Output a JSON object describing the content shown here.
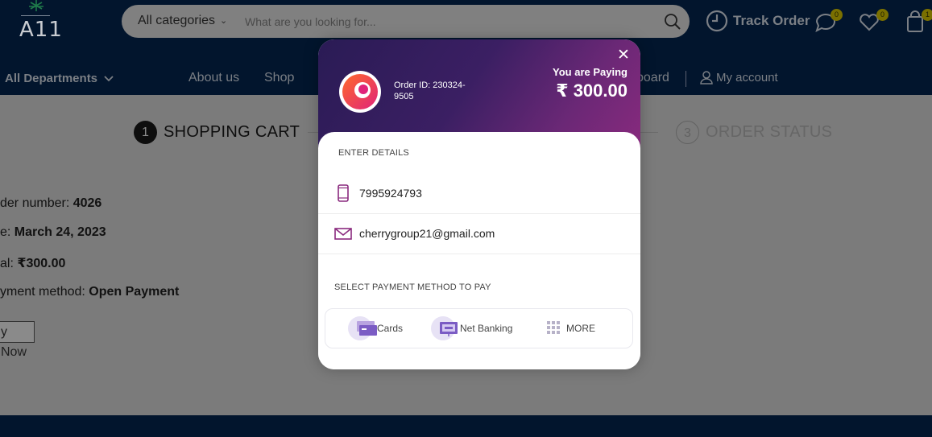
{
  "header": {
    "logo_text": "A11",
    "search": {
      "category": "All categories",
      "placeholder": "What are you looking for..."
    },
    "track_order_label": "Track Order",
    "messages_count": "0",
    "wishlist_count": "0",
    "cart_count": "1"
  },
  "nav": {
    "departments_label": "All Departments",
    "about_label": "About us",
    "shop_label": "Shop",
    "dashboard_label": "board",
    "account_label": "My account"
  },
  "checkout": {
    "steps": [
      {
        "number": "1",
        "title": "SHOPPING CART",
        "state": "active"
      },
      {
        "number": "3",
        "title": "ORDER STATUS",
        "state": "inactive"
      }
    ],
    "order_number_label": "der number: ",
    "order_number": "4026",
    "date_label": "e: ",
    "date": "March 24, 2023",
    "total_label": "al: ",
    "total": "₹300.00",
    "method_label": "yment method: ",
    "method": "Open Payment",
    "pay_now_label": "y Now"
  },
  "payment_modal": {
    "close_icon": "close-icon",
    "order_id": "Order ID: 230324-9505",
    "paying_label": "You are Paying",
    "amount": "₹ 300.00",
    "enter_details_label": "ENTER DETAILS",
    "phone": "7995924793",
    "email": "cherrygroup21@gmail.com",
    "select_method_label": "SELECT PAYMENT METHOD TO PAY",
    "methods": [
      {
        "label": "Cards",
        "icon": "card-icon"
      },
      {
        "label": "Net Banking",
        "icon": "bank-icon"
      },
      {
        "label": "MORE",
        "icon": "grid-icon"
      }
    ],
    "colors": {
      "header_gradient_start": "#2a1b55",
      "header_gradient_end": "#8a2a7e",
      "accent": "#8a2a7e"
    }
  }
}
